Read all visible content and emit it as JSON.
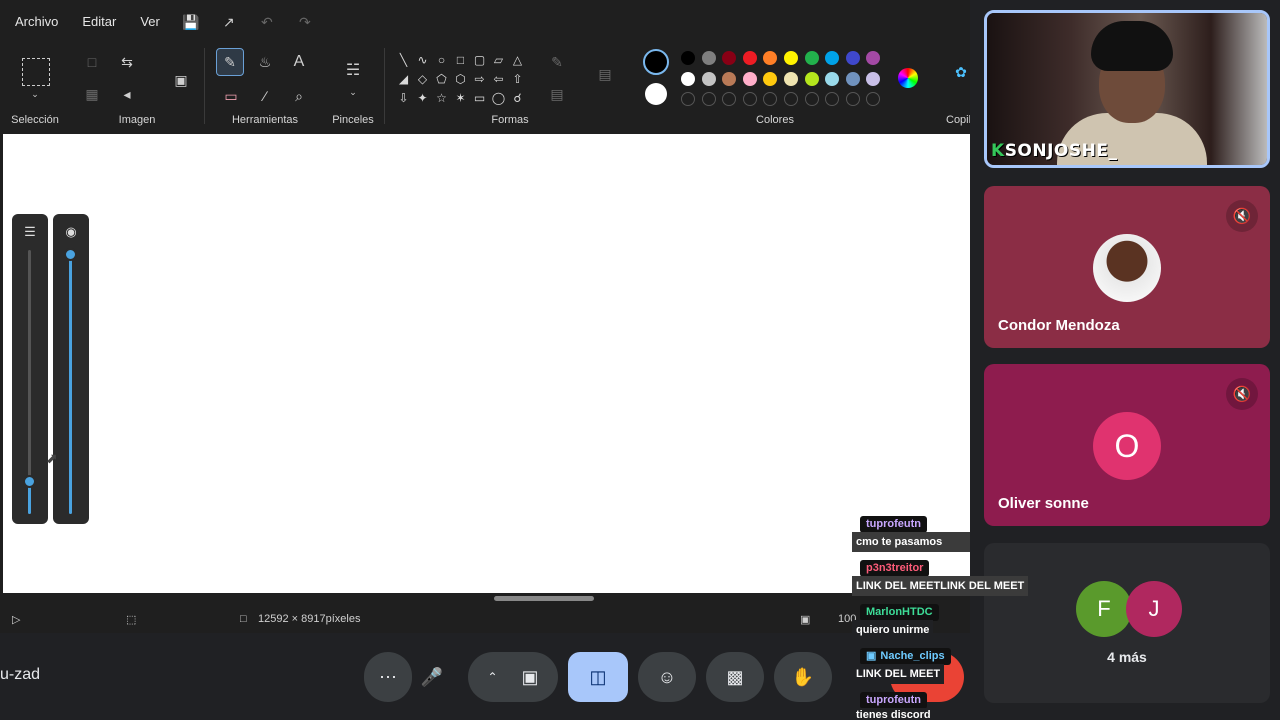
{
  "paint": {
    "menu": [
      "Archivo",
      "Editar",
      "Ver"
    ],
    "groups": {
      "selection": "Selección",
      "image": "Imagen",
      "tools": "Herramientas",
      "brushes": "Pinceles",
      "shapes": "Formas",
      "colors": "Colores",
      "copilot": "Copil"
    },
    "status": {
      "dimensions": "12592 × 8917píxeles",
      "zoom": "100"
    },
    "palette_row1": [
      "#000000",
      "#7f7f7f",
      "#880015",
      "#ed1c24",
      "#ff7f27",
      "#fff200",
      "#22b14c",
      "#00a2e8",
      "#3f48cc",
      "#a349a4"
    ],
    "palette_row2": [
      "#ffffff",
      "#c3c3c3",
      "#b97a57",
      "#ffaec9",
      "#ffc90e",
      "#efe4b0",
      "#b5e61d",
      "#99d9ea",
      "#7092be",
      "#c8bfe7"
    ],
    "color1": "#000000",
    "color2": "#ffffff",
    "size_slider_level": 0.12,
    "opacity_slider_level": 0.98
  },
  "meet": {
    "code": "u-zad",
    "controls": [
      "more-options",
      "microphone",
      "expand",
      "camera",
      "present",
      "emoji",
      "captions",
      "raise-hand",
      "end-call"
    ]
  },
  "participants": {
    "presenter_watermark": "SONJOSHE_",
    "tiles": [
      {
        "name": "Condor Mendoza",
        "muted": true,
        "bg": "#8b2d45"
      },
      {
        "name": "Oliver sonne",
        "initial": "O",
        "muted": true,
        "bg": "#8e1c4e"
      }
    ],
    "more": {
      "initials": [
        "F",
        "J"
      ],
      "label": "4 más"
    }
  },
  "chat": [
    {
      "user": "tuprofeutn",
      "text": "cmo te pasamos",
      "color": "#c9a7ff"
    },
    {
      "user": "p3n3treitor",
      "text": "LINK DEL MEETLINK DEL MEET",
      "color": "#ff5c7a"
    },
    {
      "user": "MarlonHTDC",
      "text": "quiero unirme",
      "color": "#3ddc97"
    },
    {
      "user": "Nache_clips",
      "text": "LINK DEL MEET",
      "color": "#6ecbff"
    },
    {
      "user": "tuprofeutn",
      "text": "tienes discord",
      "color": "#c9a7ff"
    }
  ]
}
